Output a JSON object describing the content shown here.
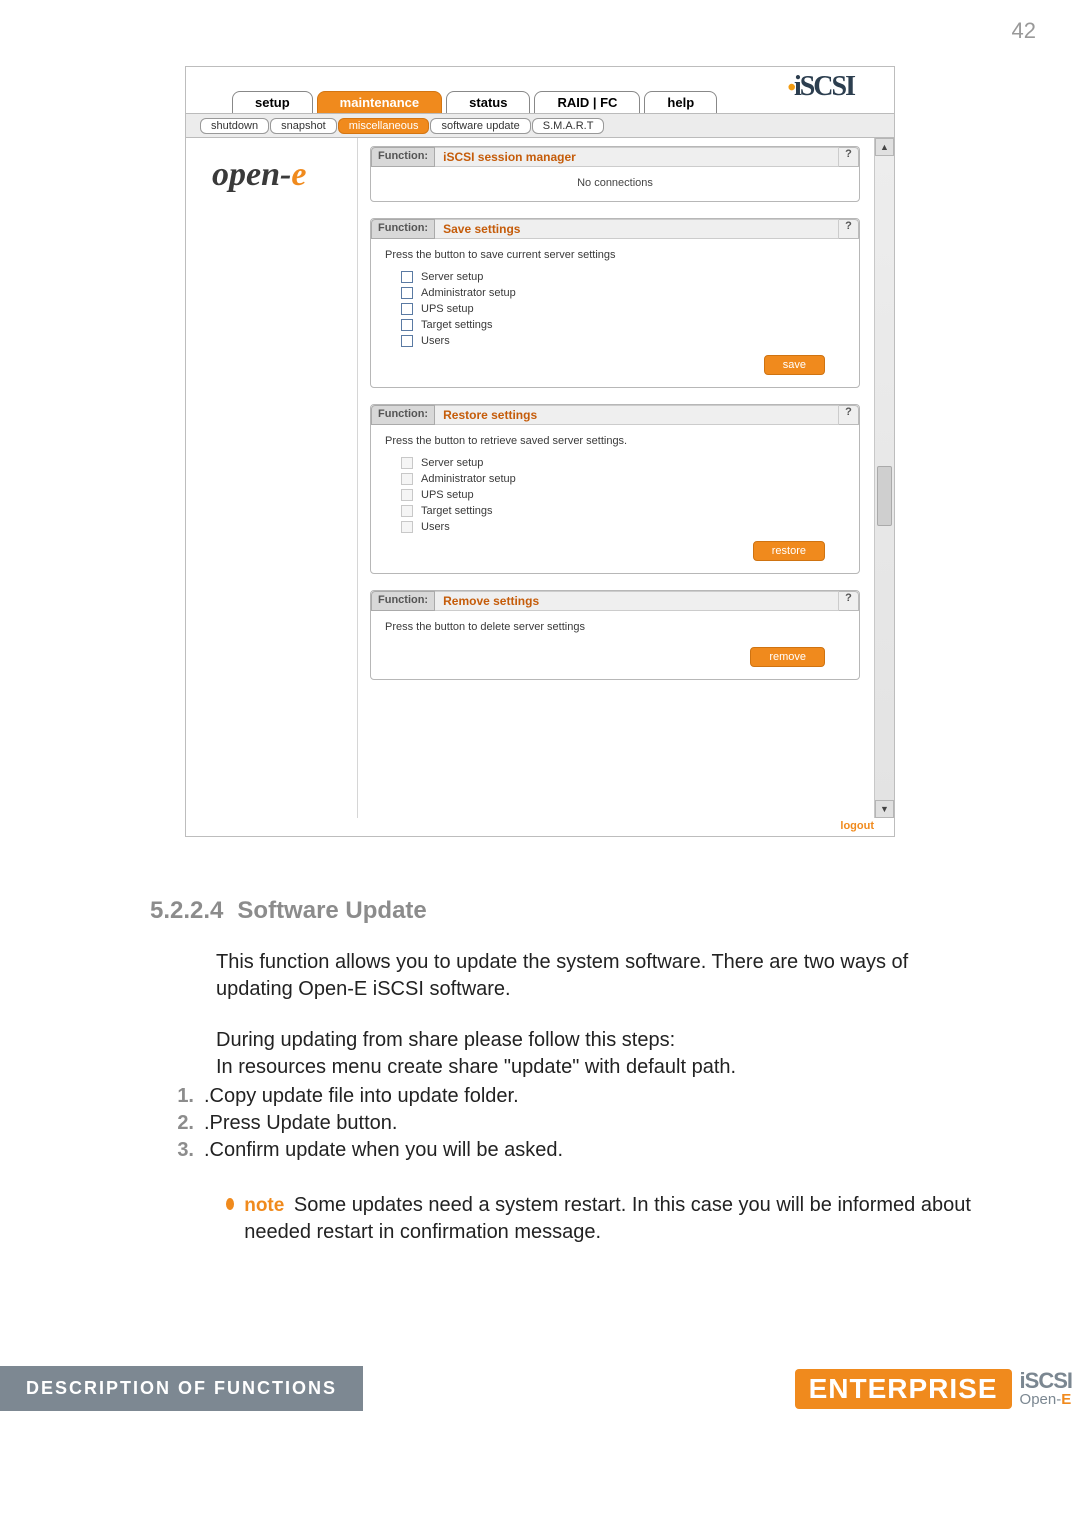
{
  "page_number": "42",
  "screenshot": {
    "brand": "iSCSI",
    "main_tabs": [
      "setup",
      "maintenance",
      "status",
      "RAID | FC",
      "help"
    ],
    "active_main_tab": 1,
    "sub_tabs": [
      "shutdown",
      "snapshot",
      "miscellaneous",
      "software update",
      "S.M.A.R.T"
    ],
    "active_sub_tab": 2,
    "logo_text_a": "open-",
    "logo_text_b": "e",
    "function_label": "Function:",
    "help_symbol": "?",
    "panels": {
      "iscsi": {
        "title": "iSCSI session manager",
        "body": "No connections"
      },
      "save": {
        "title": "Save settings",
        "msg": "Press the button to save current server settings",
        "items": [
          "Server setup",
          "Administrator setup",
          "UPS setup",
          "Target settings",
          "Users"
        ],
        "button": "save"
      },
      "restore": {
        "title": "Restore settings",
        "msg": "Press the button to retrieve saved server settings.",
        "items": [
          "Server setup",
          "Administrator setup",
          "UPS setup",
          "Target settings",
          "Users"
        ],
        "button": "restore"
      },
      "remove": {
        "title": "Remove settings",
        "msg": "Press the button to delete server settings",
        "button": "remove"
      }
    },
    "logout": "logout",
    "scroll": {
      "up": "▲",
      "down": "▼"
    }
  },
  "section": {
    "number": "5.2.2.4",
    "title": "Software Update"
  },
  "para1": "This function allows you to update the system software. There are two ways of updating  Open-E iSCSI software.",
  "para2": "During updating from share please follow this steps:",
  "para2b": " In resources menu create share \"update\" with default path.",
  "steps": [
    ".Copy update file into update folder.",
    ".Press Update button.",
    ".Confirm update when you will be asked."
  ],
  "note_label": "note",
  "note_text": " Some updates need a system restart. In this case you will be informed about needed restart in confirmation message.",
  "footer": {
    "left": "DESCRIPTION OF FUNCTIONS",
    "enterprise": "ENTERPRISE",
    "iscsi": "iSCSI",
    "open": "Open-",
    "e": "E"
  }
}
